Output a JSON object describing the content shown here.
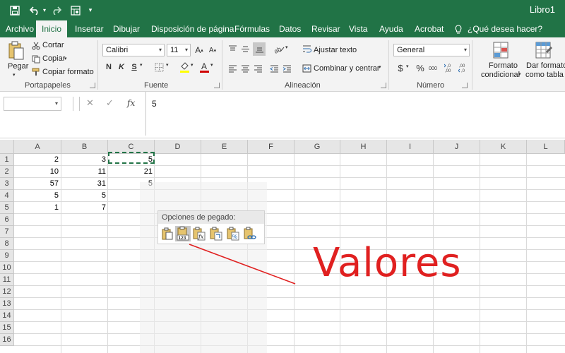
{
  "window": {
    "title": "Libro1"
  },
  "tabs": [
    {
      "label": "Archivo"
    },
    {
      "label": "Inicio",
      "active": true
    },
    {
      "label": "Insertar"
    },
    {
      "label": "Dibujar"
    },
    {
      "label": "Disposición de página"
    },
    {
      "label": "Fórmulas"
    },
    {
      "label": "Datos"
    },
    {
      "label": "Revisar"
    },
    {
      "label": "Vista"
    },
    {
      "label": "Ayuda"
    },
    {
      "label": "Acrobat"
    }
  ],
  "tell_me": {
    "label": "¿Qué desea hacer?"
  },
  "ribbon": {
    "clipboard": {
      "label": "Portapapeles",
      "paste": "Pegar",
      "cut": "Cortar",
      "copy": "Copiar",
      "format_painter": "Copiar formato"
    },
    "font": {
      "label": "Fuente",
      "font_name": "Calibri",
      "font_size": "11",
      "bold": "N",
      "italic": "K",
      "underline": "S"
    },
    "alignment": {
      "label": "Alineación",
      "wrap_text": "Ajustar texto",
      "merge_center": "Combinar y centrar"
    },
    "number": {
      "label": "Número",
      "format": "General",
      "currency": "$",
      "percent": "%",
      "comma": "000"
    },
    "styles": {
      "conditional_line1": "Formato",
      "conditional_line2": "condicional",
      "table_line1": "Dar formato",
      "table_line2": "como tabla"
    }
  },
  "formula_bar": {
    "name_box": "",
    "fx": "fx",
    "value": "5"
  },
  "columns": [
    "A",
    "B",
    "C",
    "D",
    "E",
    "F",
    "G",
    "H",
    "I",
    "J",
    "K",
    "L"
  ],
  "rows": [
    "1",
    "2",
    "3",
    "4",
    "5",
    "6",
    "7",
    "8",
    "9",
    "10",
    "11",
    "12",
    "13",
    "14",
    "15",
    "16"
  ],
  "cells": [
    {
      "ref": "A1",
      "value": "2"
    },
    {
      "ref": "B1",
      "value": "3"
    },
    {
      "ref": "C1",
      "value": "5"
    },
    {
      "ref": "A2",
      "value": "10"
    },
    {
      "ref": "B2",
      "value": "11"
    },
    {
      "ref": "C2",
      "value": "21"
    },
    {
      "ref": "A3",
      "value": "57"
    },
    {
      "ref": "B3",
      "value": "31"
    },
    {
      "ref": "C3",
      "value": "5"
    },
    {
      "ref": "A4",
      "value": "5"
    },
    {
      "ref": "B4",
      "value": "5"
    },
    {
      "ref": "A5",
      "value": "1"
    },
    {
      "ref": "B5",
      "value": "7"
    }
  ],
  "paste_options": {
    "label": "Opciones de pegado:",
    "buttons": [
      {
        "icon": "paste-icon"
      },
      {
        "icon": "paste-values-icon",
        "badge": "123",
        "selected": true
      },
      {
        "icon": "paste-formulas-icon",
        "badge": "fx"
      },
      {
        "icon": "paste-transpose-icon"
      },
      {
        "icon": "paste-formatting-icon",
        "badge": "%"
      },
      {
        "icon": "paste-link-icon"
      }
    ]
  },
  "callout": {
    "text": "Valores"
  },
  "colors": {
    "accent": "#217346",
    "callout": "#e02020"
  }
}
